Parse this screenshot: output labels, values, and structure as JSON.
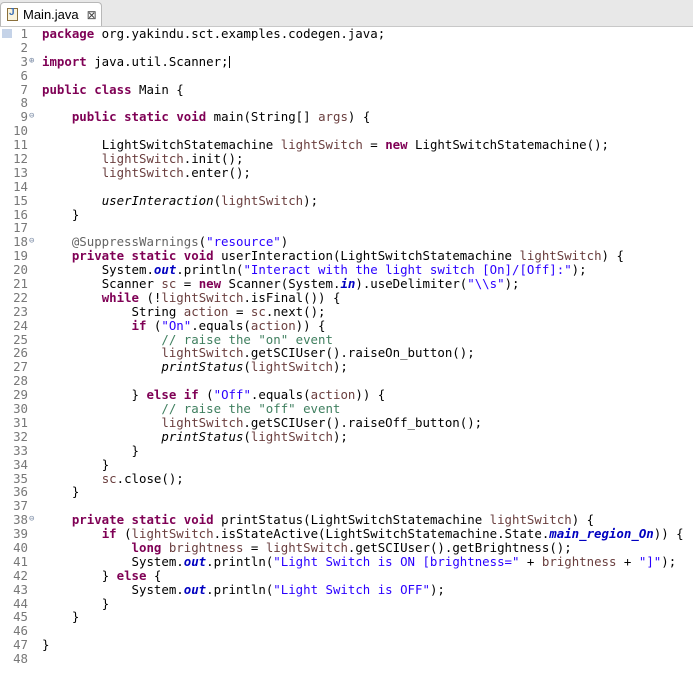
{
  "editor": {
    "tab": {
      "title": "Main.java"
    },
    "line_numbers": [
      "1",
      "2",
      "3",
      "6",
      "7",
      "8",
      "9",
      "10",
      "11",
      "12",
      "13",
      "14",
      "15",
      "16",
      "17",
      "18",
      "19",
      "20",
      "21",
      "22",
      "23",
      "24",
      "25",
      "26",
      "27",
      "28",
      "29",
      "30",
      "31",
      "32",
      "33",
      "34",
      "35",
      "36",
      "37",
      "38",
      "39",
      "40",
      "41",
      "42",
      "43",
      "44",
      "45",
      "46",
      "47",
      "48"
    ],
    "icons": {
      "file": "java-file-icon",
      "close": "close-icon",
      "fold": "fold-toggle-icon"
    }
  },
  "code": {
    "l1": [
      "package",
      " org.yakindu.sct.examples.codegen.java;"
    ],
    "l3": [
      "import",
      " java.util.Scanner;"
    ],
    "l7": [
      "public",
      " ",
      "class",
      " Main {"
    ],
    "l9": [
      "public",
      " ",
      "static",
      " ",
      "void",
      " main(String[] ",
      "args",
      ") {"
    ],
    "l11": [
      "LightSwitchStatemachine ",
      "lightSwitch",
      " = ",
      "new",
      " LightSwitchStatemachine();"
    ],
    "l12": [
      "lightSwitch",
      ".init();"
    ],
    "l13": [
      "lightSwitch",
      ".enter();"
    ],
    "l15": [
      "userInteraction",
      "(",
      "lightSwitch",
      ");"
    ],
    "l16": [
      "}"
    ],
    "l18": [
      "@SuppressWarnings",
      "(",
      "\"resource\"",
      ")"
    ],
    "l19": [
      "private",
      " ",
      "static",
      " ",
      "void",
      " userInteraction(LightSwitchStatemachine ",
      "lightSwitch",
      ") {"
    ],
    "l20": [
      "System.",
      "out",
      ".println(",
      "\"Interact with the light switch [On]/[Off]:\"",
      ");"
    ],
    "l21": [
      "Scanner ",
      "sc",
      " = ",
      "new",
      " Scanner(System.",
      "in",
      ").useDelimiter(",
      "\"\\\\s\"",
      ");"
    ],
    "l22": [
      "while",
      " (!",
      "lightSwitch",
      ".isFinal()) {"
    ],
    "l23": [
      "String ",
      "action",
      " = ",
      "sc",
      ".next();"
    ],
    "l24": [
      "if",
      " (",
      "\"On\"",
      ".equals(",
      "action",
      ")) {"
    ],
    "l25": [
      "// raise the \"on\" event"
    ],
    "l26": [
      "lightSwitch",
      ".getSCIUser().raiseOn_button();"
    ],
    "l27": [
      "printStatus",
      "(",
      "lightSwitch",
      ");"
    ],
    "l29": [
      "} ",
      "else",
      " ",
      "if",
      " (",
      "\"Off\"",
      ".equals(",
      "action",
      ")) {"
    ],
    "l30": [
      "// raise the \"off\" event"
    ],
    "l31": [
      "lightSwitch",
      ".getSCIUser().raiseOff_button();"
    ],
    "l32": [
      "printStatus",
      "(",
      "lightSwitch",
      ");"
    ],
    "l33": [
      "}"
    ],
    "l34": [
      "}"
    ],
    "l35": [
      "sc",
      ".close();"
    ],
    "l36": [
      "}"
    ],
    "l38": [
      "private",
      " ",
      "static",
      " ",
      "void",
      " printStatus(LightSwitchStatemachine ",
      "lightSwitch",
      ") {"
    ],
    "l39": [
      "if",
      " (",
      "lightSwitch",
      ".isStateActive(LightSwitchStatemachine.State.",
      "main_region_On",
      ")) {"
    ],
    "l40": [
      "long",
      " ",
      "brightness",
      " = ",
      "lightSwitch",
      ".getSCIUser().getBrightness();"
    ],
    "l41": [
      "System.",
      "out",
      ".println(",
      "\"Light Switch is ON [brightness=\"",
      " + ",
      "brightness",
      " + ",
      "\"]\"",
      ");"
    ],
    "l42": [
      "} ",
      "else",
      " {"
    ],
    "l43": [
      "System.",
      "out",
      ".println(",
      "\"Light Switch is OFF\"",
      ");"
    ],
    "l44": [
      "}"
    ],
    "l45": [
      "}"
    ],
    "l47": [
      "}"
    ]
  }
}
